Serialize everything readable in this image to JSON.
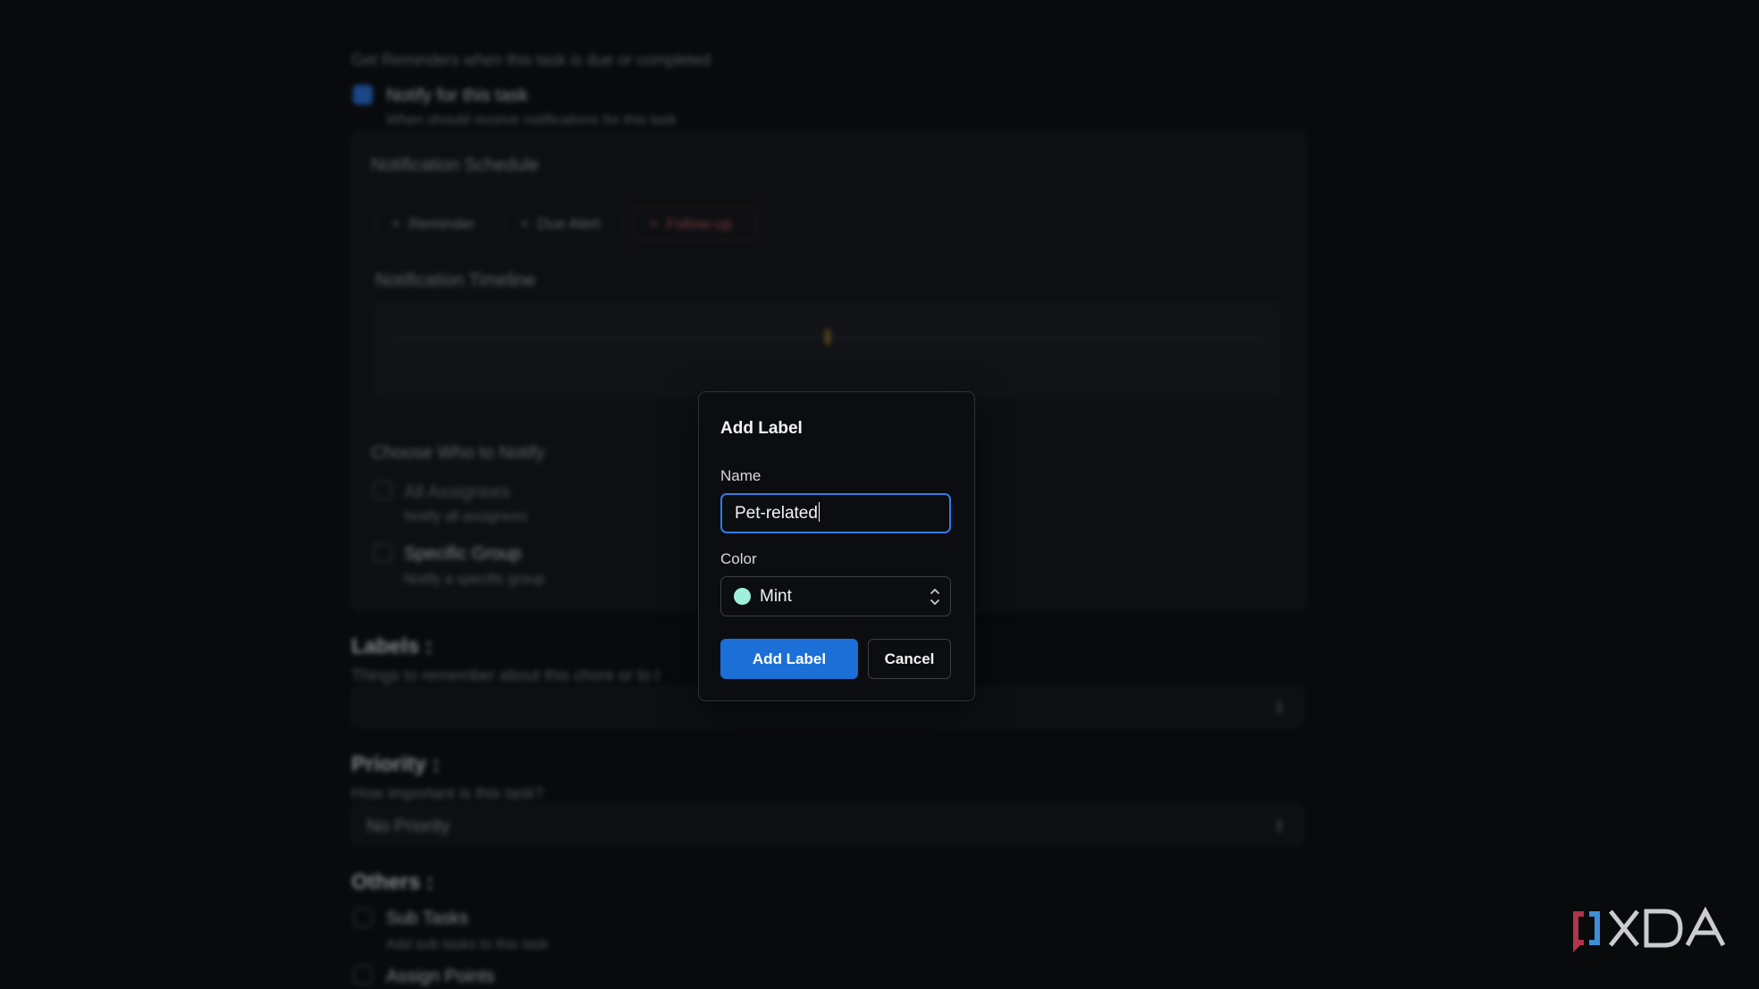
{
  "background": {
    "reminders_intro": "Get Reminders when this task is due or completed",
    "notify_checkbox_label": "Notify for this task",
    "notify_checkbox_help": "When should receive notifications for this task",
    "notification_schedule_title": "Notification Schedule",
    "schedule_buttons": [
      "Reminder",
      "Due Alert",
      "Follow-up"
    ],
    "notification_timeline_title": "Notification Timeline",
    "choose_who_title": "Choose Who to Notify",
    "all_assignees_label": "All Assignees",
    "all_assignees_help": "Notify all assignees",
    "specific_group_label": "Specific Group",
    "specific_group_help": "Notify a specific group",
    "labels_title": "Labels :",
    "labels_help": "Things to remember about this chore or to t",
    "priority_title": "Priority :",
    "priority_help": "How important is this task?",
    "priority_value": "No Priority",
    "others_title": "Others :",
    "subtasks_label": "Sub Tasks",
    "subtasks_help": "Add sub tasks to this task",
    "assign_points_label": "Assign Points"
  },
  "dialog": {
    "title": "Add Label",
    "name_label": "Name",
    "name_value": "Pet-related",
    "color_label": "Color",
    "color_value": "Mint",
    "color_swatch": "#9ef0da",
    "submit_label": "Add Label",
    "cancel_label": "Cancel"
  },
  "icons": {
    "plus": "plus-icon",
    "check": "check-icon",
    "chevron_updown": "chevron-up-down-icon"
  },
  "colors": {
    "accent": "#1b6fd6",
    "focus_ring": "#2f7be6",
    "dialog_bg": "#0c0d10"
  }
}
